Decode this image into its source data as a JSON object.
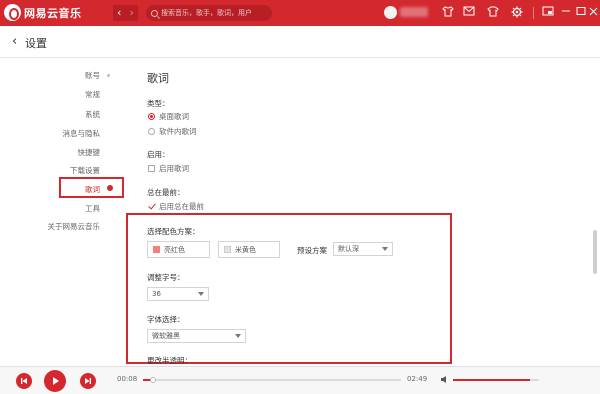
{
  "titlebar": {
    "app_name": "网易云音乐",
    "search_placeholder": "搜索音乐，歌手，歌词，用户",
    "nav_back": "‹",
    "nav_forward": "›"
  },
  "header": {
    "back_glyph": "‹",
    "title": "设置"
  },
  "sidebar": {
    "items": [
      "账号",
      "常规",
      "系统",
      "消息与隐私",
      "快捷键",
      "下载设置",
      "歌词",
      "工具",
      "关于网易云音乐"
    ],
    "active_index": 6
  },
  "lyrics": {
    "section_title": "歌词",
    "type_label": "类型：",
    "type_options": [
      {
        "label": "桌面歌词",
        "selected": true
      },
      {
        "label": "软件内歌词",
        "selected": false
      }
    ],
    "enable_label": "启用：",
    "enable_option": {
      "label": "启用歌词",
      "checked": false
    },
    "topmost_label": "总在最前：",
    "topmost_option": {
      "label": "启用总在最前",
      "checked": true
    },
    "color_scheme_label": "选择配色方案：",
    "schemes": [
      {
        "label": "亮红色",
        "color": "#f08080"
      },
      {
        "label": "米黄色",
        "color": "#e8e8e8"
      }
    ],
    "preset_label": "预设方案",
    "preset_value": "默认深",
    "font_size_label": "调整字号：",
    "font_size_value": "36",
    "font_label": "字体选择：",
    "font_value": "微软雅黑",
    "more_label": "更改半透明："
  },
  "player": {
    "time_current": "00:08",
    "time_total": "02:49",
    "progress": 0.04,
    "volume": 0.9
  },
  "colors": {
    "accent": "#d2282e"
  }
}
